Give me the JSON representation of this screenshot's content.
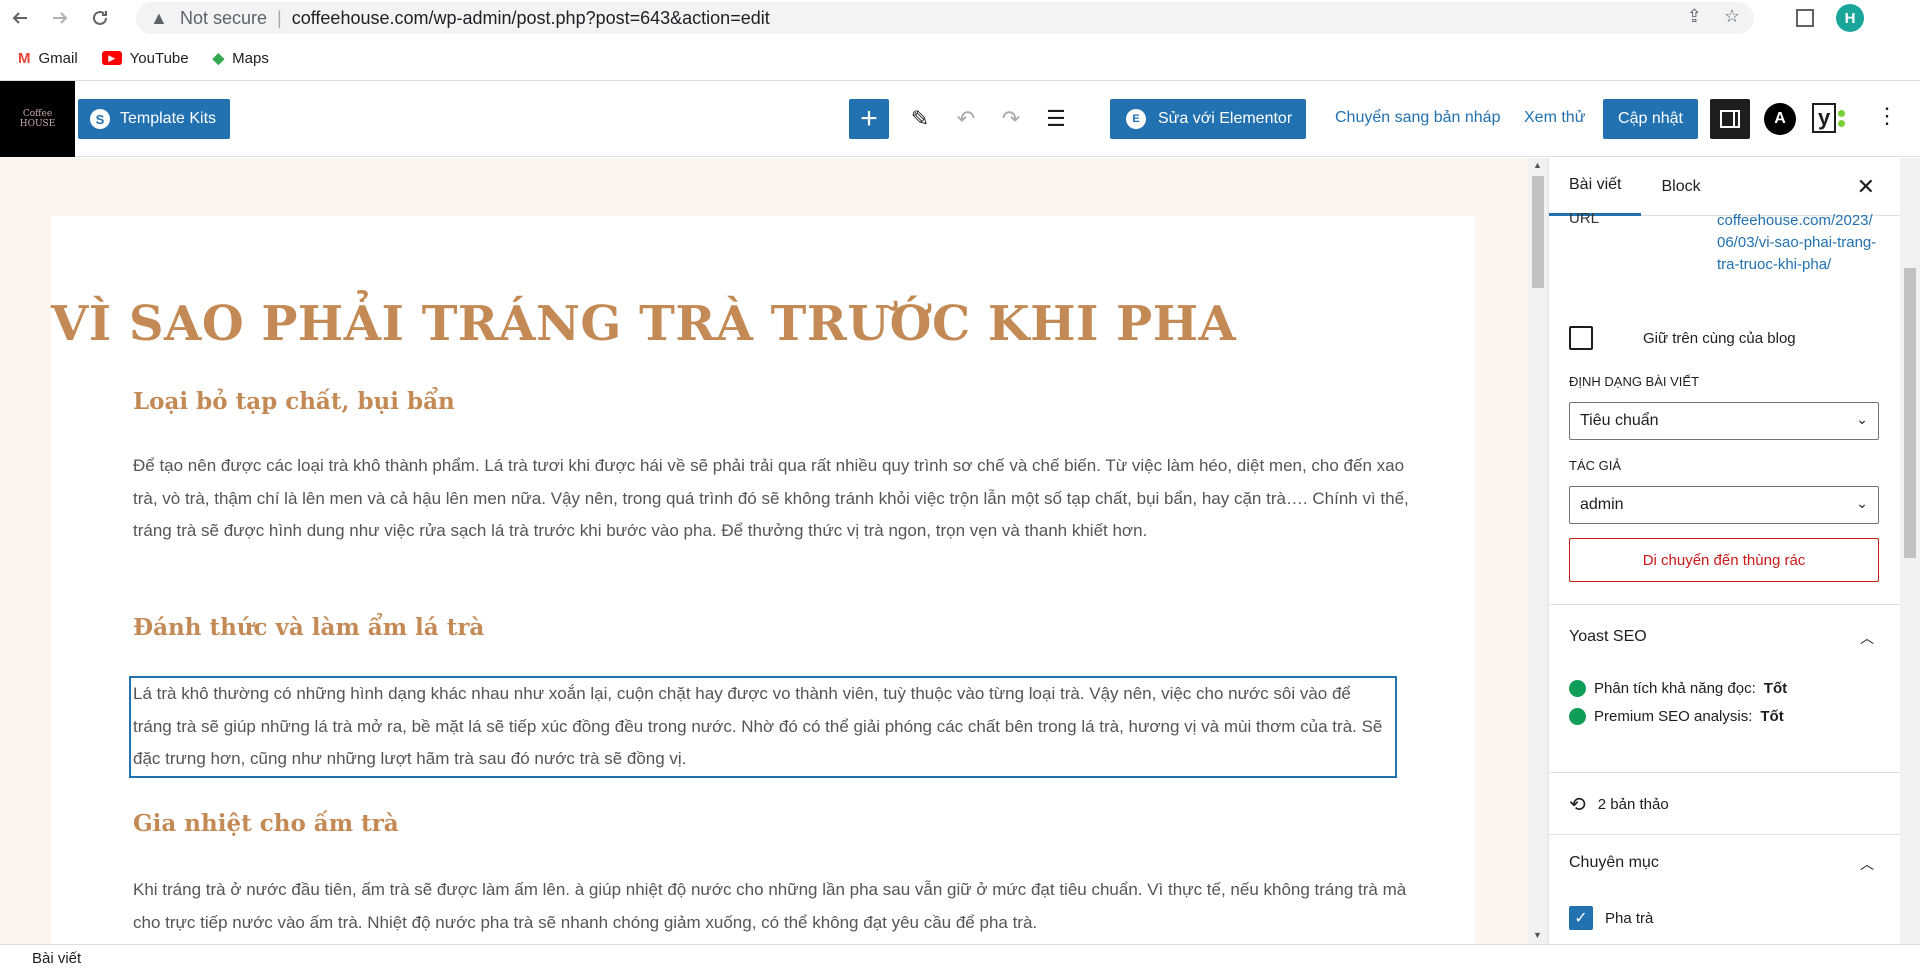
{
  "browser": {
    "not_secure": "Not secure",
    "url": "coffeehouse.com/wp-admin/post.php?post=643&action=edit",
    "avatar_letter": "H",
    "bookmarks": [
      {
        "label": "Gmail",
        "icon": "gmail-icon"
      },
      {
        "label": "YouTube",
        "icon": "youtube-icon"
      },
      {
        "label": "Maps",
        "icon": "maps-icon"
      }
    ]
  },
  "toolbar": {
    "template_kits": "Template Kits",
    "edit_elementor": "Sửa với Elementor",
    "switch_draft": "Chuyển sang bản nháp",
    "preview": "Xem thử",
    "update": "Cập nhật",
    "astra_letter": "A",
    "yoast_letter": "y"
  },
  "post": {
    "title": "VÌ SAO PHẢI TRÁNG TRÀ TRƯỚC KHI PHA",
    "h1": "Loại bỏ tạp chất, bụi bẩn",
    "p1": "Để tạo nên được các loại trà khô thành phẩm. Lá trà tươi khi được hái về sẽ phải trải qua rất nhiều quy trình sơ chế và chế biến. Từ việc làm héo, diệt men, cho đến xao trà, vò trà, thậm chí là lên men và cả hậu lên men nữa. Vậy nên, trong quá trình đó sẽ không tránh khỏi việc trộn lẫn một số tạp chất, bụi bẩn, hay cặn trà…. Chính vì thế, tráng trà sẽ được hình dung như việc rửa sạch lá trà trước khi bước vào pha. Để thưởng thức vị trà ngon, trọn vẹn và thanh khiết hơn.",
    "h2": "Đánh thức và làm ẩm lá trà",
    "p2": "Lá trà khô thường có những hình dạng khác nhau như xoắn lại, cuộn chặt hay được vo thành viên, tuỳ thuộc vào từng loại trà. Vậy nên, việc cho nước sôi vào để tráng trà sẽ giúp những lá trà mở ra, bề mặt lá sẽ tiếp xúc đồng đều trong nước. Nhờ đó có thể giải phóng các chất bên trong lá trà, hương vị và mùi thơm của trà. Sẽ đặc trưng hơn, cũng như những lượt hãm trà sau đó nước trà sẽ đồng vị.",
    "h3": "Gia nhiệt cho ấm trà",
    "p3": "Khi tráng trà ở nước đầu tiên, ấm trà sẽ được làm ấm lên. à giúp nhiệt độ nước cho những lần pha sau vẫn giữ ở mức đạt tiêu chuẩn. Vì thực tế, nếu không tráng trà mà cho trực tiếp nước vào ấm trà. Nhiệt độ nước pha trà sẽ nhanh chóng giảm xuống, có thể không đạt yêu cầu để pha trà."
  },
  "sidebar": {
    "tab_post": "Bài viết",
    "tab_block": "Block",
    "url_label": "URL",
    "url_value": "coffeehouse.com/2023/06/03/vi-sao-phai-trang-tra-truoc-khi-pha/",
    "sticky_label": "Giữ trên cùng của blog",
    "format_label": "ĐỊNH DẠNG BÀI VIẾT",
    "format_value": "Tiêu chuẩn",
    "author_label": "TÁC GIẢ",
    "author_value": "admin",
    "trash": "Di chuyển đến thùng rác",
    "yoast_title": "Yoast SEO",
    "seo_readability": "Phân tích khả năng đọc:",
    "seo_readability_val": "Tốt",
    "seo_premium": "Premium SEO analysis:",
    "seo_premium_val": "Tốt",
    "revisions": "2 bản thảo",
    "categories_title": "Chuyên mục",
    "category_item": "Pha trà"
  },
  "footer": {
    "breadcrumb": "Bài viết"
  }
}
